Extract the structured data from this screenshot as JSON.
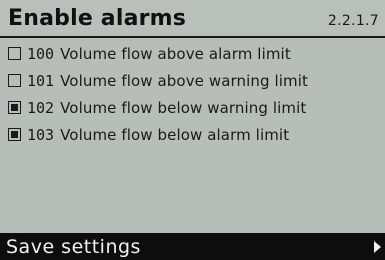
{
  "header": {
    "title": "Enable alarms",
    "menu_code": "2.2.1.7"
  },
  "alarms": [
    {
      "code": "100",
      "label": "Volume flow above alarm limit",
      "enabled": false
    },
    {
      "code": "101",
      "label": "Volume flow above warning limit",
      "enabled": false
    },
    {
      "code": "102",
      "label": "Volume flow below warning limit",
      "enabled": true
    },
    {
      "code": "103",
      "label": "Volume flow below alarm limit",
      "enabled": true
    }
  ],
  "footer": {
    "label": "Save settings",
    "icon": "chevron-right-icon"
  },
  "colors": {
    "screen_background": "#b7bdb9",
    "text": "#1a1a1a",
    "footer_background": "#0d0d0d",
    "footer_text": "#f2f2f2"
  }
}
